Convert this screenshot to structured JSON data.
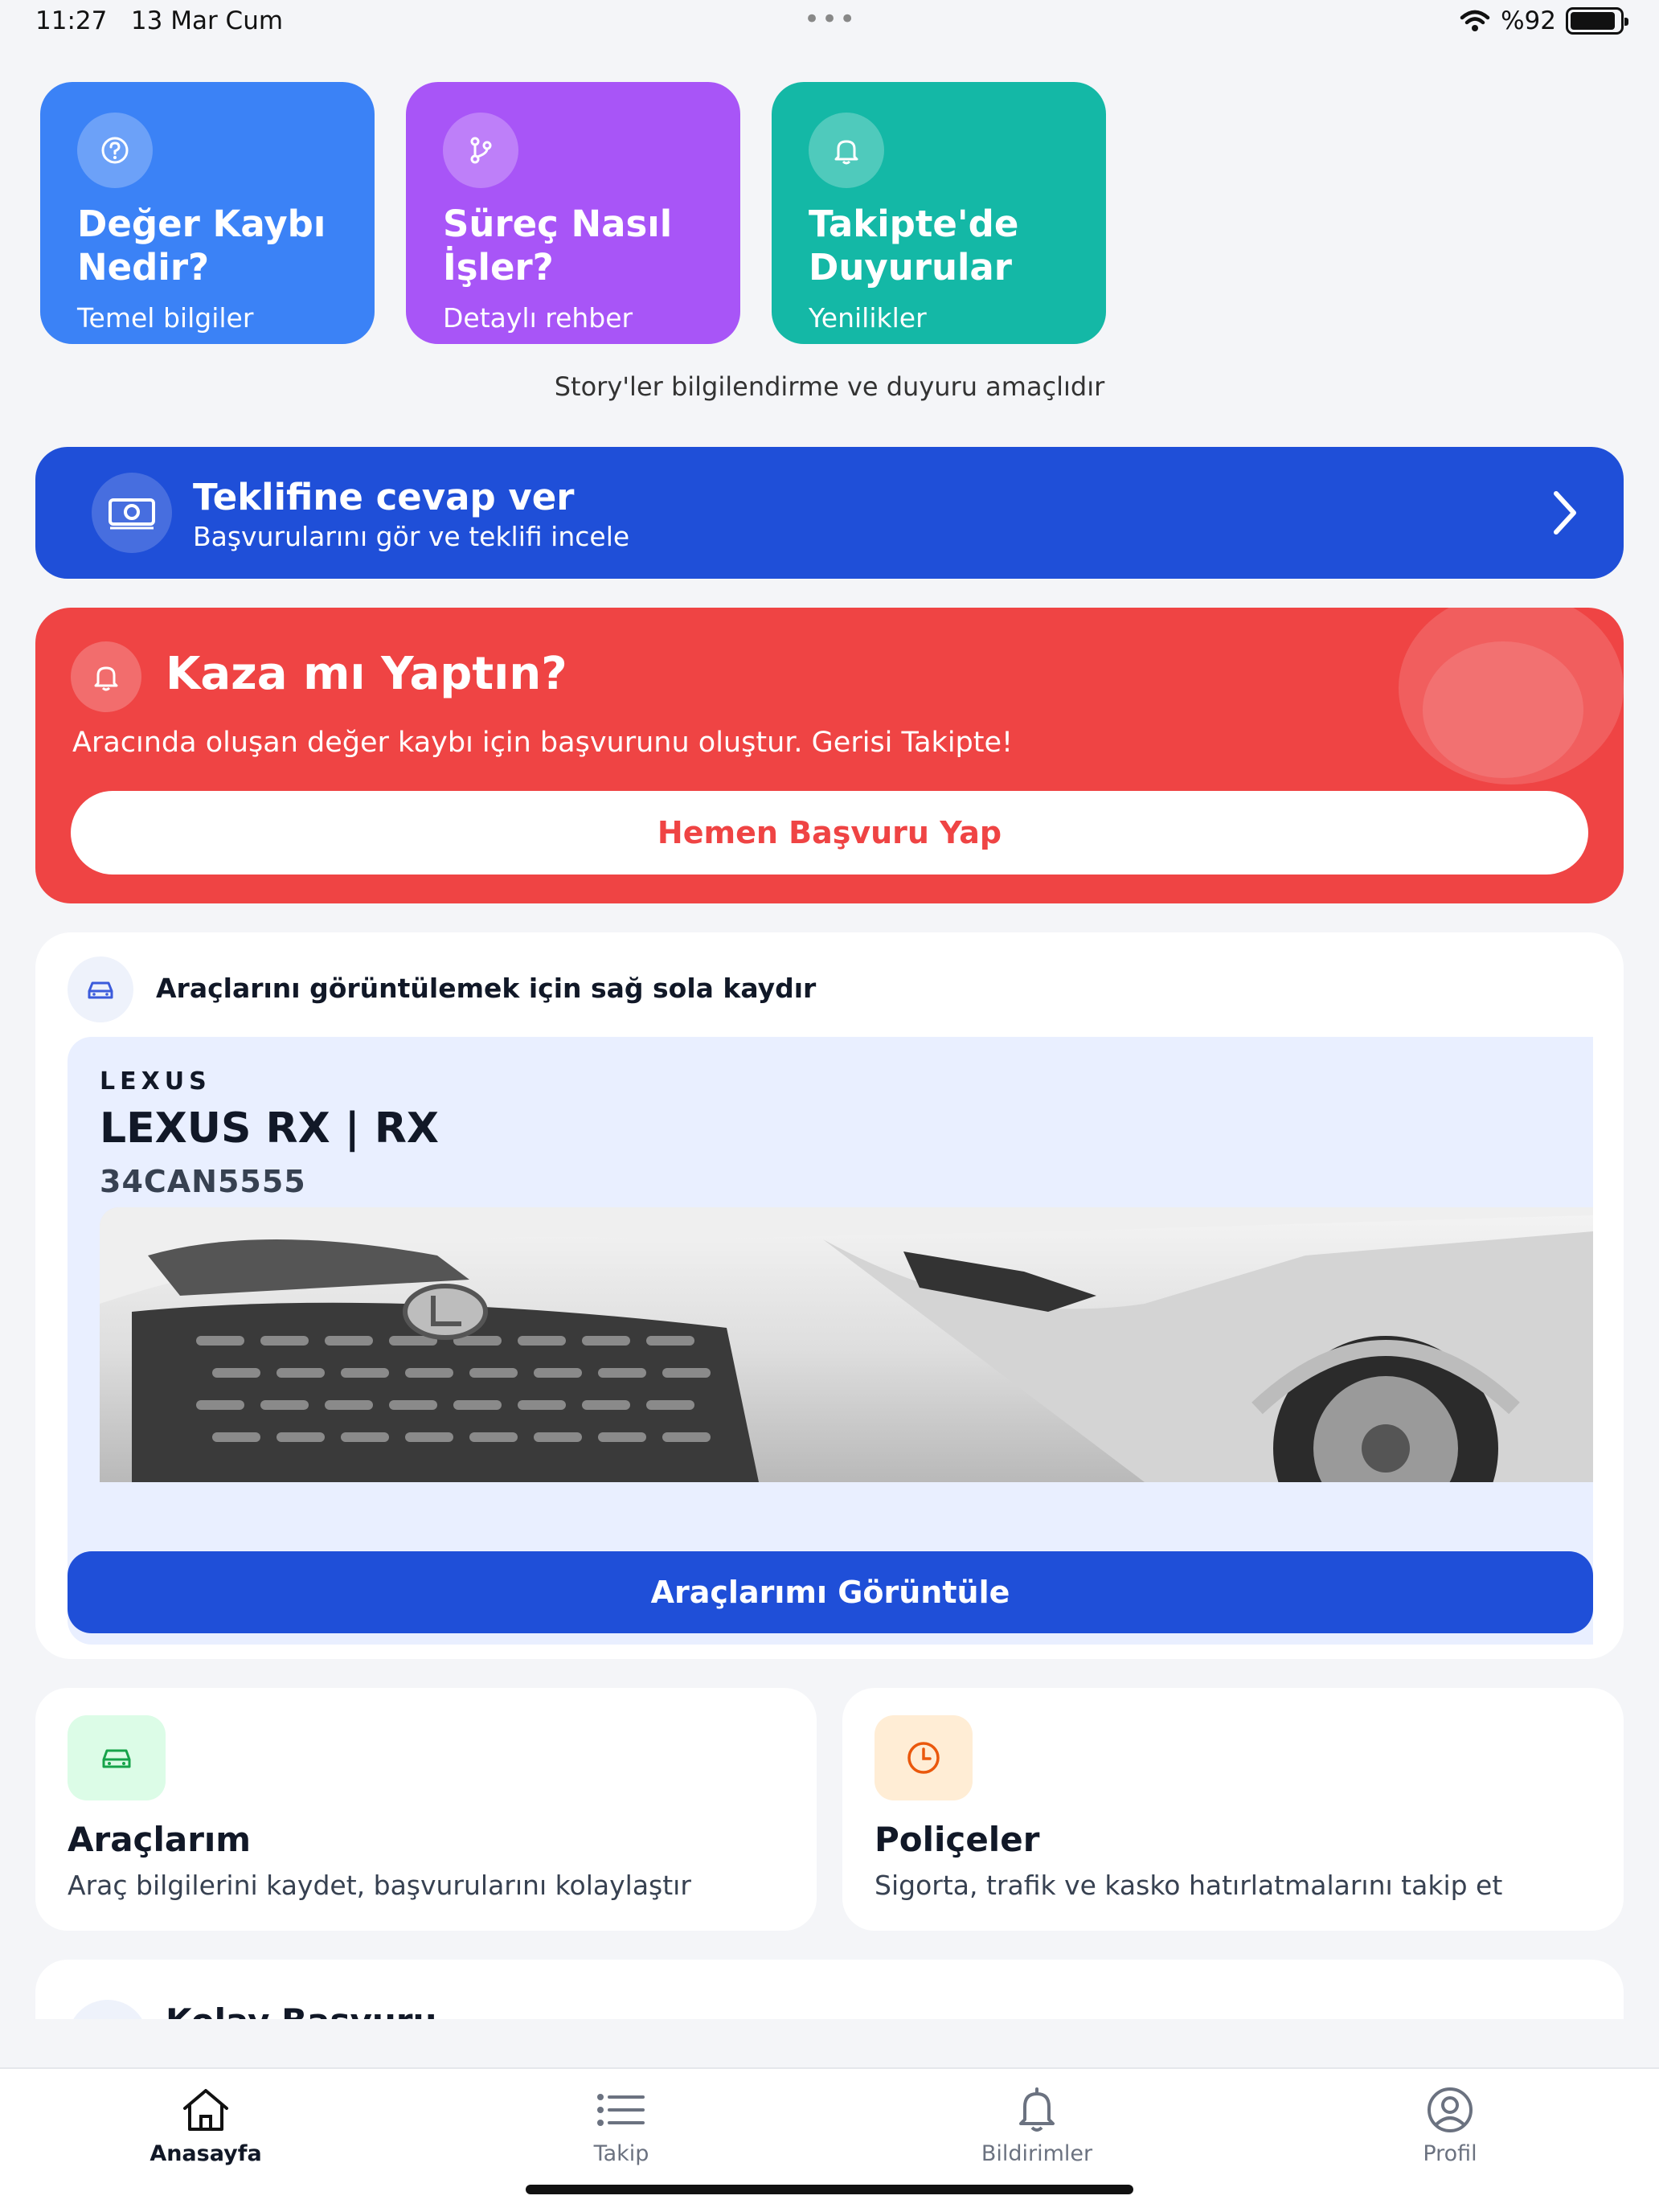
{
  "status_bar": {
    "time": "11:27",
    "date": "13 Mar Cum",
    "dots": "•••",
    "battery": "%92",
    "battery_level": 0.92
  },
  "stories": [
    {
      "title": "Değer Kaybı Nedir?",
      "subtitle": "Temel bilgiler",
      "icon": "question-circle-icon",
      "color": "#3b82f6"
    },
    {
      "title": "Süreç Nasıl İşler?",
      "subtitle": "Detaylı rehber",
      "icon": "git-branch-icon",
      "color": "#a855f7"
    },
    {
      "title": "Takipte'de Duyurular",
      "subtitle": "Yenilikler",
      "icon": "bell-icon",
      "color": "#14b8a6"
    }
  ],
  "story_note": "Story'ler bilgilendirme ve duyuru amaçlıdır",
  "offer": {
    "title": "Teklifine cevap ver",
    "subtitle": "Başvurularını gör ve teklifi incele",
    "icon": "money-icon"
  },
  "accident": {
    "title": "Kaza mı Yaptın?",
    "subtitle": "Aracında oluşan değer kaybı için başvurunu oluştur. Gerisi Takipte!",
    "button": "Hemen Başvuru Yap",
    "icon": "bell-icon"
  },
  "vehicles": {
    "hint": "Araçlarını görüntülemek için sağ sola kaydır",
    "brand": "LEXUS",
    "model": "LEXUS RX | RX",
    "plate": "34CAN5555",
    "button": "Araçlarımı Görüntüle"
  },
  "features": [
    {
      "title": "Araçlarım",
      "subtitle": "Araç bilgilerini kaydet, başvurularını kolaylaştır",
      "icon": "car-icon",
      "color": "#dcfce7"
    },
    {
      "title": "Poliçeler",
      "subtitle": "Sigorta, trafik ve kasko hatırlatmalarını takip et",
      "icon": "clock-icon",
      "color": "#ffedd5"
    }
  ],
  "partial_card": {
    "title": "Kolay Başvuru"
  },
  "tabs": [
    {
      "label": "Anasayfa",
      "icon": "home-icon",
      "active": true
    },
    {
      "label": "Takip",
      "icon": "list-icon",
      "active": false
    },
    {
      "label": "Bildirimler",
      "icon": "bell-icon",
      "active": false
    },
    {
      "label": "Profil",
      "icon": "profile-icon",
      "active": false
    }
  ]
}
